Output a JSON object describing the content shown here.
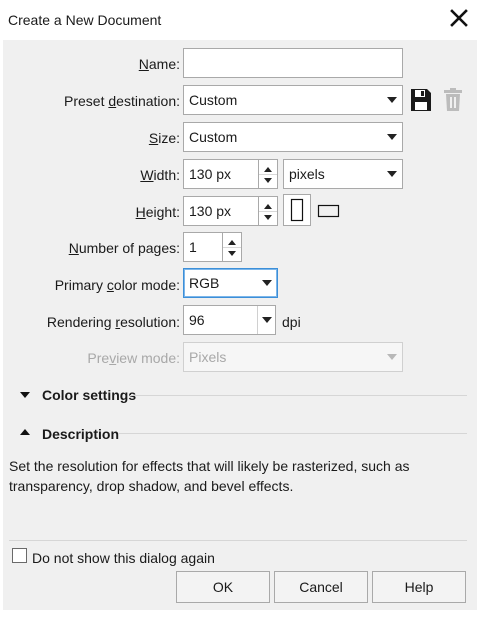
{
  "window": {
    "title": "Create a New Document"
  },
  "form": {
    "name": {
      "label_underlined": "N",
      "label_rest": "ame:",
      "value": ""
    },
    "preset": {
      "label_before": "Preset ",
      "label_underlined": "d",
      "label_rest": "estination:",
      "value": "Custom"
    },
    "size": {
      "label_underlined": "S",
      "label_rest": "ize:",
      "value": "Custom"
    },
    "width": {
      "label_underlined": "W",
      "label_rest": "idth:",
      "value": "130 px",
      "unit": "pixels"
    },
    "height": {
      "label_underlined": "H",
      "label_rest": "eight:",
      "value": "130 px"
    },
    "pages": {
      "label_underlined": "N",
      "label_rest": "umber of pages:",
      "value": "1"
    },
    "color_mode": {
      "label_before": "Primary ",
      "label_underlined": "c",
      "label_rest": "olor mode:",
      "value": "RGB"
    },
    "resolution": {
      "label_before": "Rendering ",
      "label_underlined": "r",
      "label_rest": "esolution:",
      "value": "96",
      "unit": "dpi"
    },
    "preview": {
      "label_before": "Pre",
      "label_underlined": "v",
      "label_rest": "iew mode:",
      "value": "Pixels"
    }
  },
  "sections": {
    "color_settings": "Color settings",
    "description": "Description"
  },
  "description_text": "Set the resolution for effects that will likely be rasterized, such as transparency, drop shadow, and bevel effects.",
  "footer": {
    "checkbox_label": "Do not show this dialog again",
    "ok": "OK",
    "cancel": "Cancel",
    "help": "Help"
  },
  "icons": {
    "save_preset": "floppy-disk-icon",
    "delete_preset": "trash-icon",
    "portrait": "portrait-orientation-icon",
    "landscape": "landscape-orientation-icon",
    "close": "close-icon"
  },
  "colors": {
    "focus_border": "#3c8fd8",
    "dialog_bg": "#f0f0f0"
  }
}
